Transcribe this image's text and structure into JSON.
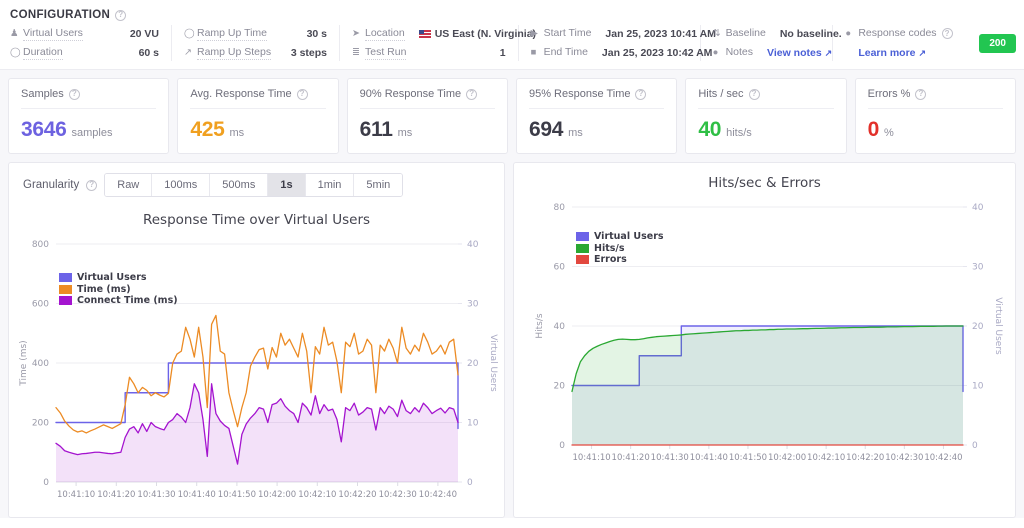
{
  "config": {
    "title": "CONFIGURATION",
    "help_icon": "help-circle-icon",
    "groups": [
      {
        "rows": [
          {
            "icon": "user-icon",
            "label": "Virtual Users",
            "value": "20 VU"
          },
          {
            "icon": "clock-icon",
            "label": "Duration",
            "value": "60 s"
          }
        ]
      },
      {
        "rows": [
          {
            "icon": "clock-icon",
            "label": "Ramp Up Time",
            "value": "30 s"
          },
          {
            "icon": "trending-up-icon",
            "label": "Ramp Up Steps",
            "value": "3 steps"
          }
        ]
      },
      {
        "rows": [
          {
            "icon": "location-arrow-icon",
            "label": "Location",
            "value": "US East (N. Virginia)",
            "flag": "us-flag-icon"
          },
          {
            "icon": "list-icon",
            "label": "Test Run",
            "value": "1"
          }
        ]
      },
      {
        "rows": [
          {
            "icon": "play-icon",
            "label": "Start Time",
            "value": "Jan 25, 2023 10:41 AM"
          },
          {
            "icon": "stop-icon",
            "label": "End Time",
            "value": "Jan 25, 2023 10:42 AM"
          }
        ]
      },
      {
        "rows": [
          {
            "icon": "baseline-icon",
            "label": "Baseline",
            "value": "No baseline."
          },
          {
            "icon": "notes-icon",
            "label": "Notes",
            "value": "View notes",
            "link": true,
            "external": "↗"
          }
        ]
      }
    ],
    "response_codes": {
      "icon": "circle-icon",
      "label": "Response codes",
      "help_icon": "help-circle-icon",
      "learn_more": "Learn more",
      "external": "↗",
      "badge": "200",
      "badge_color": "#22c651"
    }
  },
  "cards": [
    {
      "title": "Samples",
      "value": "3646",
      "unit": "samples",
      "color": "#6d62e0"
    },
    {
      "title": "Avg. Response Time",
      "value": "425",
      "unit": "ms",
      "color": "#f0a020"
    },
    {
      "title": "90% Response Time",
      "value": "611",
      "unit": "ms",
      "color": "#3c3c48"
    },
    {
      "title": "95% Response Time",
      "value": "694",
      "unit": "ms",
      "color": "#3c3c48"
    },
    {
      "title": "Hits / sec",
      "value": "40",
      "unit": "hits/s",
      "color": "#2fbf45"
    },
    {
      "title": "Errors %",
      "value": "0",
      "unit": "%",
      "color": "#e2302a"
    }
  ],
  "granularity": {
    "label": "Granularity",
    "help_icon": "help-circle-icon",
    "options": [
      "Raw",
      "100ms",
      "500ms",
      "1s",
      "1min",
      "5min"
    ],
    "selected": "1s"
  },
  "chart_data": [
    {
      "id": "response-time-over-virtual-users",
      "type": "line",
      "title": "Response Time over Virtual Users",
      "xlabel": "",
      "ylabel": "Time (ms)",
      "y2label": "Virtual Users",
      "ylim": [
        0,
        800
      ],
      "yticks": [
        0,
        200,
        400,
        600,
        800
      ],
      "y2lim": [
        0,
        40
      ],
      "y2ticks": [
        0,
        10,
        20,
        30,
        40
      ],
      "grid": true,
      "legend_position": "top-left",
      "xticks": [
        "10:41:10",
        "10:41:20",
        "10:41:30",
        "10:41:40",
        "10:41:50",
        "10:42:00",
        "10:42:10",
        "10:42:20",
        "10:42:30",
        "10:42:40"
      ],
      "xlim": [
        "10:41:05",
        "10:42:42"
      ],
      "series": [
        {
          "name": "Virtual Users",
          "color": "#6c63e8",
          "axis": "right",
          "style": "step",
          "fill": false,
          "values": [
            10,
            10,
            10,
            10,
            10,
            10,
            10,
            10,
            10,
            10,
            10,
            10,
            10,
            10,
            10,
            10,
            15,
            15,
            15,
            15,
            15,
            15,
            15,
            15,
            15,
            15,
            20,
            20,
            20,
            20,
            20,
            20,
            20,
            20,
            20,
            20,
            20,
            20,
            20,
            20,
            20,
            20,
            20,
            20,
            20,
            20,
            20,
            20,
            20,
            20,
            20,
            20,
            20,
            20,
            20,
            20,
            20,
            20,
            20,
            20,
            20,
            20,
            20,
            20,
            20,
            20,
            20,
            20,
            20,
            20,
            20,
            20,
            20,
            20,
            20,
            20,
            20,
            20,
            20,
            20,
            20,
            20,
            20,
            20,
            20,
            20,
            20,
            20,
            20,
            20,
            20,
            20,
            20,
            9
          ]
        },
        {
          "name": "Time (ms)",
          "color": "#ec8b24",
          "axis": "left",
          "style": "line",
          "fill": false,
          "values": [
            250,
            232,
            205,
            188,
            175,
            168,
            172,
            165,
            172,
            178,
            185,
            192,
            186,
            180,
            188,
            196,
            260,
            352,
            330,
            300,
            318,
            308,
            290,
            300,
            292,
            286,
            298,
            400,
            430,
            440,
            520,
            480,
            420,
            520,
            420,
            250,
            530,
            560,
            440,
            430,
            300,
            240,
            186,
            250,
            300,
            390,
            420,
            445,
            450,
            380,
            452,
            420,
            500,
            460,
            480,
            450,
            420,
            500,
            440,
            300,
            455,
            430,
            520,
            460,
            470,
            405,
            300,
            470,
            455,
            500,
            430,
            440,
            480,
            460,
            300,
            460,
            440,
            480,
            450,
            400,
            520,
            450,
            430,
            460,
            440,
            500,
            470,
            430,
            440,
            460,
            430,
            470,
            480,
            360
          ]
        },
        {
          "name": "Connect Time (ms)",
          "color": "#a414cf",
          "axis": "left",
          "style": "area",
          "fill": true,
          "values": [
            130,
            120,
            105,
            100,
            96,
            92,
            95,
            96,
            98,
            100,
            100,
            98,
            96,
            95,
            98,
            100,
            150,
            178,
            186,
            165,
            196,
            170,
            200,
            186,
            180,
            175,
            200,
            210,
            230,
            218,
            200,
            250,
            330,
            300,
            210,
            86,
            330,
            230,
            205,
            190,
            180,
            120,
            60,
            160,
            195,
            215,
            230,
            250,
            245,
            200,
            260,
            265,
            280,
            255,
            240,
            230,
            200,
            265,
            250,
            225,
            290,
            230,
            260,
            240,
            245,
            210,
            135,
            250,
            240,
            265,
            225,
            235,
            250,
            245,
            175,
            250,
            230,
            255,
            245,
            220,
            275,
            240,
            230,
            250,
            235,
            265,
            250,
            230,
            240,
            248,
            232,
            250,
            245,
            200
          ]
        }
      ]
    },
    {
      "id": "hits-sec-and-errors",
      "type": "line",
      "title": "Hits/sec & Errors",
      "xlabel": "",
      "ylabel": "Hits/s",
      "y2label": "Virtual Users",
      "ylim": [
        0,
        80
      ],
      "yticks": [
        0,
        20,
        40,
        60,
        80
      ],
      "y2lim": [
        0,
        40
      ],
      "y2ticks": [
        0,
        10,
        20,
        30,
        40
      ],
      "grid": true,
      "legend_position": "top-left",
      "xticks": [
        "10:41:10",
        "10:41:20",
        "10:41:30",
        "10:41:40",
        "10:41:50",
        "10:42:00",
        "10:42:10",
        "10:42:20",
        "10:42:30",
        "10:42:40"
      ],
      "xlim": [
        "10:41:05",
        "10:42:42"
      ],
      "series": [
        {
          "name": "Virtual Users",
          "color": "#6c63e8",
          "axis": "right",
          "style": "step",
          "fill": true,
          "values": [
            10,
            10,
            10,
            10,
            10,
            10,
            10,
            10,
            10,
            10,
            10,
            10,
            10,
            10,
            10,
            10,
            15,
            15,
            15,
            15,
            15,
            15,
            15,
            15,
            15,
            15,
            20,
            20,
            20,
            20,
            20,
            20,
            20,
            20,
            20,
            20,
            20,
            20,
            20,
            20,
            20,
            20,
            20,
            20,
            20,
            20,
            20,
            20,
            20,
            20,
            20,
            20,
            20,
            20,
            20,
            20,
            20,
            20,
            20,
            20,
            20,
            20,
            20,
            20,
            20,
            20,
            20,
            20,
            20,
            20,
            20,
            20,
            20,
            20,
            20,
            20,
            20,
            20,
            20,
            20,
            20,
            20,
            20,
            20,
            20,
            20,
            20,
            20,
            20,
            20,
            20,
            20,
            20,
            9
          ]
        },
        {
          "name": "Hits/s",
          "color": "#2aa832",
          "axis": "left",
          "style": "area",
          "fill": true,
          "values": [
            18,
            24,
            28,
            30,
            31.5,
            32.5,
            33.2,
            33.8,
            34.3,
            34.8,
            35.2,
            35.5,
            35.6,
            35.5,
            35.4,
            35.4,
            35.5,
            35.7,
            36,
            36.2,
            36.4,
            36.5,
            36.6,
            36.7,
            36.8,
            36.9,
            37,
            37.2,
            37.3,
            37.4,
            37.5,
            37.6,
            37.7,
            37.8,
            37.9,
            38,
            38.1,
            38.2,
            38.3,
            38.4,
            38.4,
            38.5,
            38.5,
            38.6,
            38.6,
            38.7,
            38.7,
            38.8,
            38.8,
            38.9,
            38.9,
            39,
            39,
            39,
            39.05,
            39.1,
            39.1,
            39.15,
            39.2,
            39.2,
            39.25,
            39.3,
            39.3,
            39.35,
            39.4,
            39.4,
            39.45,
            39.5,
            39.5,
            39.5,
            39.55,
            39.6,
            39.6,
            39.6,
            39.65,
            39.7,
            39.7,
            39.7,
            39.75,
            39.8,
            39.8,
            39.8,
            39.85,
            39.9,
            39.9,
            39.9,
            39.9,
            39.95,
            39.95,
            40,
            40,
            40,
            40,
            40
          ]
        },
        {
          "name": "Errors",
          "color": "#e2483f",
          "axis": "left",
          "style": "line",
          "fill": false,
          "values": [
            0,
            0,
            0,
            0,
            0,
            0,
            0,
            0,
            0,
            0,
            0,
            0,
            0,
            0,
            0,
            0,
            0,
            0,
            0,
            0,
            0,
            0,
            0,
            0,
            0,
            0,
            0,
            0,
            0,
            0,
            0,
            0,
            0,
            0,
            0,
            0,
            0,
            0,
            0,
            0,
            0,
            0,
            0,
            0,
            0,
            0,
            0,
            0,
            0,
            0,
            0,
            0,
            0,
            0,
            0,
            0,
            0,
            0,
            0,
            0,
            0,
            0,
            0,
            0,
            0,
            0,
            0,
            0,
            0,
            0,
            0,
            0,
            0,
            0,
            0,
            0,
            0,
            0,
            0,
            0,
            0,
            0,
            0,
            0,
            0,
            0,
            0,
            0,
            0,
            0,
            0,
            0,
            0,
            0
          ]
        }
      ]
    }
  ]
}
